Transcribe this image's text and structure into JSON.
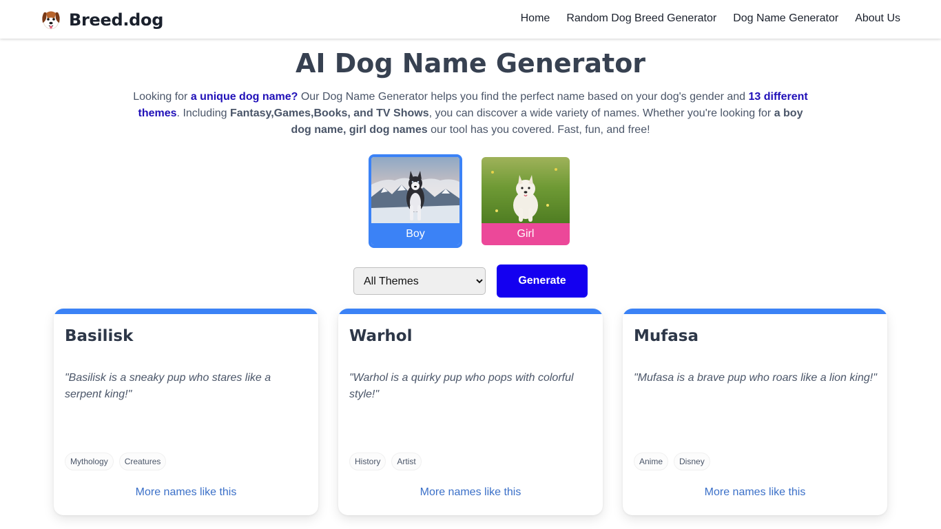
{
  "header": {
    "brand": "Breed.dog",
    "nav": [
      "Home",
      "Random Dog Breed Generator",
      "Dog Name Generator",
      "About Us"
    ]
  },
  "hero": {
    "title": "AI Dog Name Generator",
    "intro": {
      "t1": "Looking for ",
      "h1": "a unique dog name?",
      "t2": " Our Dog Name Generator helps you find the perfect name based on your dog's gender and ",
      "h2": "13 different themes",
      "t3": ". Including ",
      "b1": "Fantasy,Games,Books, and TV Shows",
      "t4": ", you can discover a wide variety of names. Whether you're looking for ",
      "b2": "a boy dog name, girl dog names",
      "t5": " our tool has you covered. Fast, fun, and free!"
    }
  },
  "gender": {
    "options": [
      "Boy",
      "Girl"
    ],
    "selected": "Boy"
  },
  "controls": {
    "theme_selected": "All Themes",
    "generate_label": "Generate"
  },
  "colors": {
    "accent_blue": "#3b82f6",
    "girl_pink": "#ec4899",
    "generate_button": "#1400f0",
    "link": "#3b70c8"
  },
  "cards": [
    {
      "name": "Basilisk",
      "quote": "\"Basilisk is a sneaky pup who stares like a serpent king!\"",
      "tags": [
        "Mythology",
        "Creatures"
      ],
      "more": "More names like this"
    },
    {
      "name": "Warhol",
      "quote": "\"Warhol is a quirky pup who pops with colorful style!\"",
      "tags": [
        "History",
        "Artist"
      ],
      "more": "More names like this"
    },
    {
      "name": "Mufasa",
      "quote": "\"Mufasa is a brave pup who roars like a lion king!\"",
      "tags": [
        "Anime",
        "Disney"
      ],
      "more": "More names like this"
    }
  ]
}
